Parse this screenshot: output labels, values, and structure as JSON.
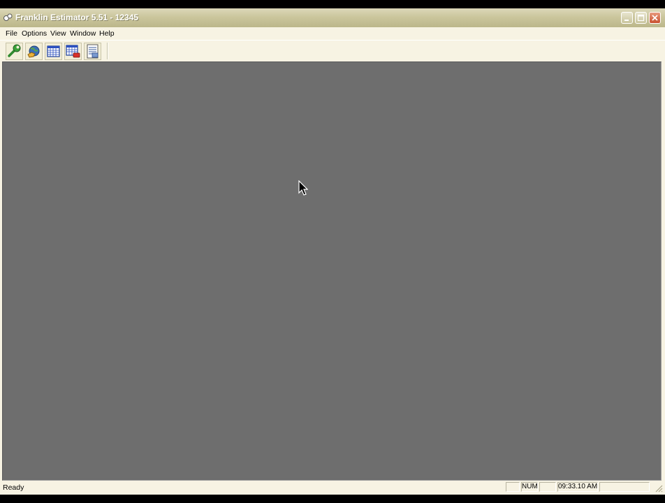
{
  "window": {
    "title": "Franklin Estimator 5.51 - 12345"
  },
  "menu": {
    "items": [
      {
        "label": "File"
      },
      {
        "label": "Options"
      },
      {
        "label": "View"
      },
      {
        "label": "Window"
      },
      {
        "label": "Help"
      }
    ]
  },
  "toolbar": {
    "buttons": [
      {
        "icon": "wrench-icon"
      },
      {
        "icon": "globe-hand-icon"
      },
      {
        "icon": "calendar-grid-icon"
      },
      {
        "icon": "calendar-schedule-icon"
      },
      {
        "icon": "report-icon"
      }
    ]
  },
  "status": {
    "message": "Ready",
    "panes": [
      "",
      "NUM",
      "",
      "09:33.10 AM",
      ""
    ]
  },
  "colors": {
    "workspace": "#6e6e6e",
    "chrome": "#f7f3e3",
    "titlebar": "#cbc69d"
  }
}
